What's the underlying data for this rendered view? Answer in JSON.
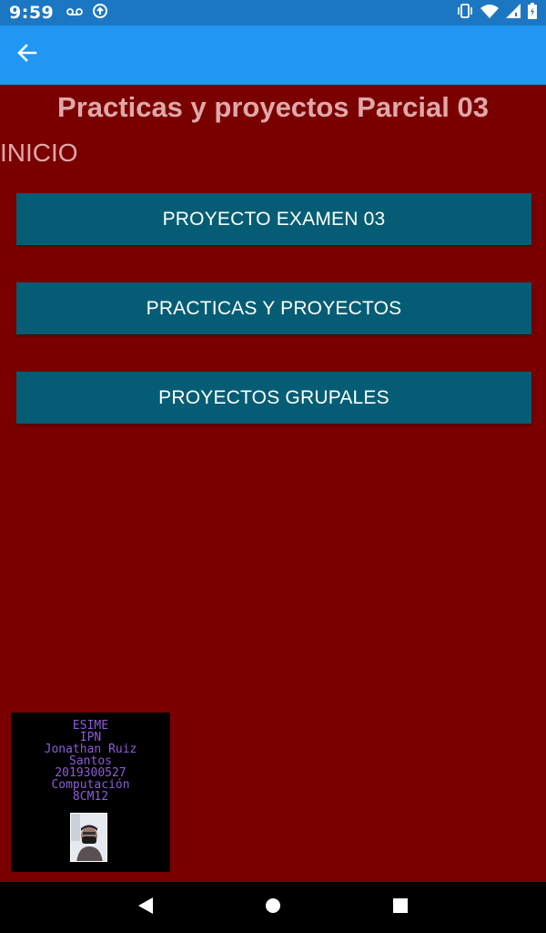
{
  "status_bar": {
    "time": "9:59",
    "left_icons": [
      "voicemail-icon",
      "sync-icon"
    ],
    "right_icons": [
      "vibrate-icon",
      "wifi-icon",
      "signal-icon",
      "battery-icon"
    ]
  },
  "app_bar": {
    "back_icon": "arrow-back-icon",
    "color": "#2196f3"
  },
  "page": {
    "title": "Practicas y proyectos Parcial 03",
    "section_label": "INICIO",
    "background": "#7a0000"
  },
  "buttons": [
    {
      "label": "PROYECTO EXAMEN 03"
    },
    {
      "label": "PRACTICAS Y PROYECTOS"
    },
    {
      "label": "PROYECTOS GRUPALES"
    }
  ],
  "id_card": {
    "lines": [
      "ESIME",
      "IPN",
      "Jonathan Ruiz",
      "Santos",
      "2019300527",
      "Computación",
      "8CM12"
    ],
    "text_color": "#8d5cd9"
  },
  "nav_bar": {
    "buttons": [
      "back-triangle-icon",
      "home-circle-icon",
      "recents-square-icon"
    ]
  }
}
